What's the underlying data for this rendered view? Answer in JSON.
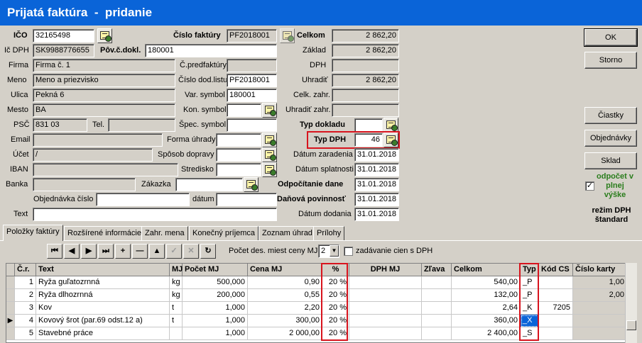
{
  "window": {
    "title": "Prijatá faktúra  -  pridanie"
  },
  "labels": {
    "ico": "IČO",
    "ic_dph": "Ič DPH",
    "firma": "Firma",
    "meno": "Meno",
    "ulica": "Ulica",
    "mesto": "Mesto",
    "psc": "PSČ",
    "tel": "Tel.",
    "email": "Email",
    "ucet": "Účet",
    "iban": "IBAN",
    "banka": "Banka",
    "objednavka_cislo": "Objednávka číslo",
    "text": "Text",
    "cislo_faktury": "Číslo faktúry",
    "pov_c_dokl": "Pôv.č.dokl.",
    "c_predfaktury": "Č.predfaktúry",
    "cislo_dod_listu": "Číslo dod.listu",
    "var_symbol": "Var. symbol",
    "kon_symbol": "Kon. symbol",
    "spec_symbol": "Špec. symbol",
    "forma_uhrady": "Forma úhrady",
    "sposob_dopravy": "Spôsob dopravy",
    "stredisko": "Stredisko",
    "zakazka": "Zákazka",
    "datum": "dátum",
    "celkom": "Celkom",
    "zaklad": "Základ",
    "dph": "DPH",
    "uhradit": "Uhradiť",
    "celk_zahr": "Celk. zahr.",
    "uhradit_zahr": "Uhradiť zahr.",
    "typ_dokladu": "Typ dokladu",
    "typ_dph": "Typ DPH",
    "datum_zaradenia": "Dátum zaradenia",
    "datum_splatnosti": "Dátum splatnosti",
    "odpocitanie_dane": "Odpočítanie dane",
    "danova_povinnost": "Daňová povinnosť",
    "datum_dodania": "Dátum dodania"
  },
  "fields": {
    "ico": "32165498",
    "ic_dph": "SK9988776655",
    "pov_c_dokl": "180001",
    "firma": "Firma č. 1",
    "meno": "Meno a priezvisko",
    "ulica": "Pekná 6",
    "mesto": "BA",
    "psc": "831 03",
    "ucet": "/",
    "cislo_faktury": "PF2018001",
    "cislo_dod_listu": "PF2018001",
    "var_symbol": "180001",
    "celkom": "2 862,20",
    "zaklad": "2 862,20",
    "uhradit": "2 862,20",
    "typ_dph": "46",
    "datum_zaradenia": "31.01.2018",
    "datum_splatnosti": "31.01.2018",
    "odpocitanie_dane": "31.01.2018",
    "danova_povinnost": "31.01.2018",
    "datum_dodania": "31.01.2018"
  },
  "buttons": {
    "ok": "OK",
    "storno": "Storno",
    "ciastky": "Čiastky",
    "objednavky": "Objednávky",
    "sklad": "Sklad"
  },
  "odpocet": {
    "text": "odpočet v plnej výške",
    "checked": "✓"
  },
  "rezim": "režim DPH štandard",
  "tabs": [
    "Položky faktúry",
    "Rozšírené informácie",
    "Zahr. mena",
    "Konečný príjemca",
    "Zoznam úhrad",
    "Prílohy"
  ],
  "toolbar": {
    "first": "⏮",
    "prev": "◀",
    "next": "▶",
    "last": "⏭",
    "add": "+",
    "remove": "—",
    "up": "▲",
    "check": "✓",
    "cancel": "✕",
    "refresh": "↻",
    "decimals_label": "Počet des. miest ceny MJ",
    "decimals_value": "2",
    "dph_prices_label": "zadávanie cien s DPH"
  },
  "table": {
    "headers": [
      "Č.r.",
      "Text",
      "MJ",
      "Počet MJ",
      "Cena MJ",
      "%",
      "DPH MJ",
      "Zľava",
      "Celkom",
      "Typ",
      "Kód CS",
      "Číslo karty"
    ],
    "rows": [
      {
        "cr": "1",
        "text": "Ryža guľatozrnná",
        "mj": "kg",
        "pocet": "500,000",
        "cena": "0,90",
        "pct": "20 %",
        "dph": "",
        "zlava": "",
        "celkom": "540,00",
        "typ": "_P",
        "kod": "",
        "karta": "1,00"
      },
      {
        "cr": "2",
        "text": "Ryža dlhozrnná",
        "mj": "kg",
        "pocet": "200,000",
        "cena": "0,55",
        "pct": "20 %",
        "dph": "",
        "zlava": "",
        "celkom": "132,00",
        "typ": "_P",
        "kod": "",
        "karta": "2,00"
      },
      {
        "cr": "3",
        "text": "Kov",
        "mj": "t",
        "pocet": "1,000",
        "cena": "2,20",
        "pct": "20 %",
        "dph": "",
        "zlava": "",
        "celkom": "2,64",
        "typ": "_K",
        "kod": "7205",
        "karta": ""
      },
      {
        "cr": "4",
        "text": "Kovový šrot (par.69 odst.12 a)",
        "mj": "t",
        "pocet": "1,000",
        "cena": "300,00",
        "pct": "20 %",
        "dph": "",
        "zlava": "",
        "celkom": "360,00",
        "typ": "_X",
        "kod": "",
        "karta": ""
      },
      {
        "cr": "5",
        "text": "Stavebné práce",
        "mj": "",
        "pocet": "1,000",
        "cena": "2 000,00",
        "pct": "20 %",
        "dph": "",
        "zlava": "",
        "celkom": "2 400,00",
        "typ": "_S",
        "kod": "",
        "karta": ""
      }
    ]
  }
}
